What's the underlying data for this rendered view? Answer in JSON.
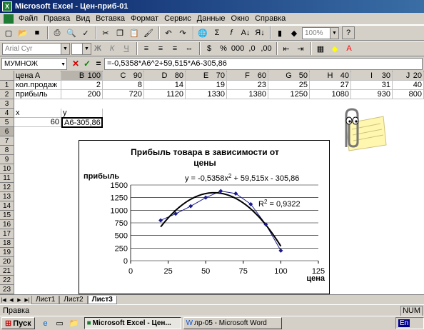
{
  "window": {
    "title": "Microsoft Excel - Цен-приб-01",
    "app_icon": "excel-icon"
  },
  "menu": [
    "Файл",
    "Правка",
    "Вид",
    "Вставка",
    "Формат",
    "Сервис",
    "Данные",
    "Окно",
    "Справка"
  ],
  "toolbar": {
    "zoom": "100%",
    "font_name": "Arial Cyr",
    "help": "?"
  },
  "formula_bar": {
    "name_box": "МУМНОЖ",
    "formula": "=-0,5358*A6^2+59,515*A6-305,86"
  },
  "columns": [
    "A",
    "B",
    "C",
    "D",
    "E",
    "F",
    "G",
    "H",
    "I",
    "J"
  ],
  "rows": [
    "1",
    "2",
    "3",
    "4",
    "5",
    "6",
    "7",
    "8",
    "9",
    "10",
    "11",
    "12",
    "13",
    "14",
    "15",
    "16",
    "17",
    "18",
    "19",
    "20",
    "21",
    "22",
    "23"
  ],
  "cells": {
    "a1": "цена",
    "a2": "кол.продаж",
    "a3": "прибыль",
    "r1": [
      "100",
      "90",
      "80",
      "70",
      "60",
      "50",
      "40",
      "30",
      "20"
    ],
    "r2": [
      "2",
      "8",
      "14",
      "19",
      "23",
      "25",
      "27",
      "31",
      "40"
    ],
    "r3": [
      "200",
      "720",
      "1120",
      "1330",
      "1380",
      "1250",
      "1080",
      "930",
      "800"
    ],
    "a5": "x",
    "b5": "y",
    "a6": "60",
    "b6": "A6-305,86"
  },
  "chart": {
    "title": "Прибыль товара в зависимости от цены",
    "ylabel": "прибыль",
    "xlabel": "цена",
    "equation": "y = -0,5358x",
    "eq_sup": "2",
    "eq_rest": " + 59,515x - 305,86",
    "r2": "R",
    "r2_sup": "2",
    "r2_rest": " = 0,9322"
  },
  "chart_data": {
    "type": "scatter",
    "series": [
      {
        "x": [
          20,
          30,
          40,
          50,
          60,
          70,
          80,
          90,
          100
        ],
        "y": [
          800,
          930,
          1080,
          1250,
          1380,
          1330,
          1120,
          720,
          200
        ]
      }
    ],
    "trendline": {
      "a": -0.5358,
      "b": 59.515,
      "c": -305.86
    },
    "xlim": [
      0,
      125
    ],
    "ylim": [
      0,
      1500
    ],
    "xticks": [
      "0",
      "25",
      "50",
      "75",
      "100",
      "125"
    ],
    "yticks": [
      "0",
      "250",
      "500",
      "750",
      "1000",
      "1250",
      "1500"
    ],
    "grid": true
  },
  "sheets": [
    "Лист1",
    "Лист2",
    "Лист3"
  ],
  "status": "Правка",
  "status_right": "NUM",
  "taskbar": {
    "start": "Пуск",
    "tasks": [
      "Microsoft Excel - Цен...",
      "лр-05 - Microsoft Word"
    ],
    "lang": "En"
  }
}
